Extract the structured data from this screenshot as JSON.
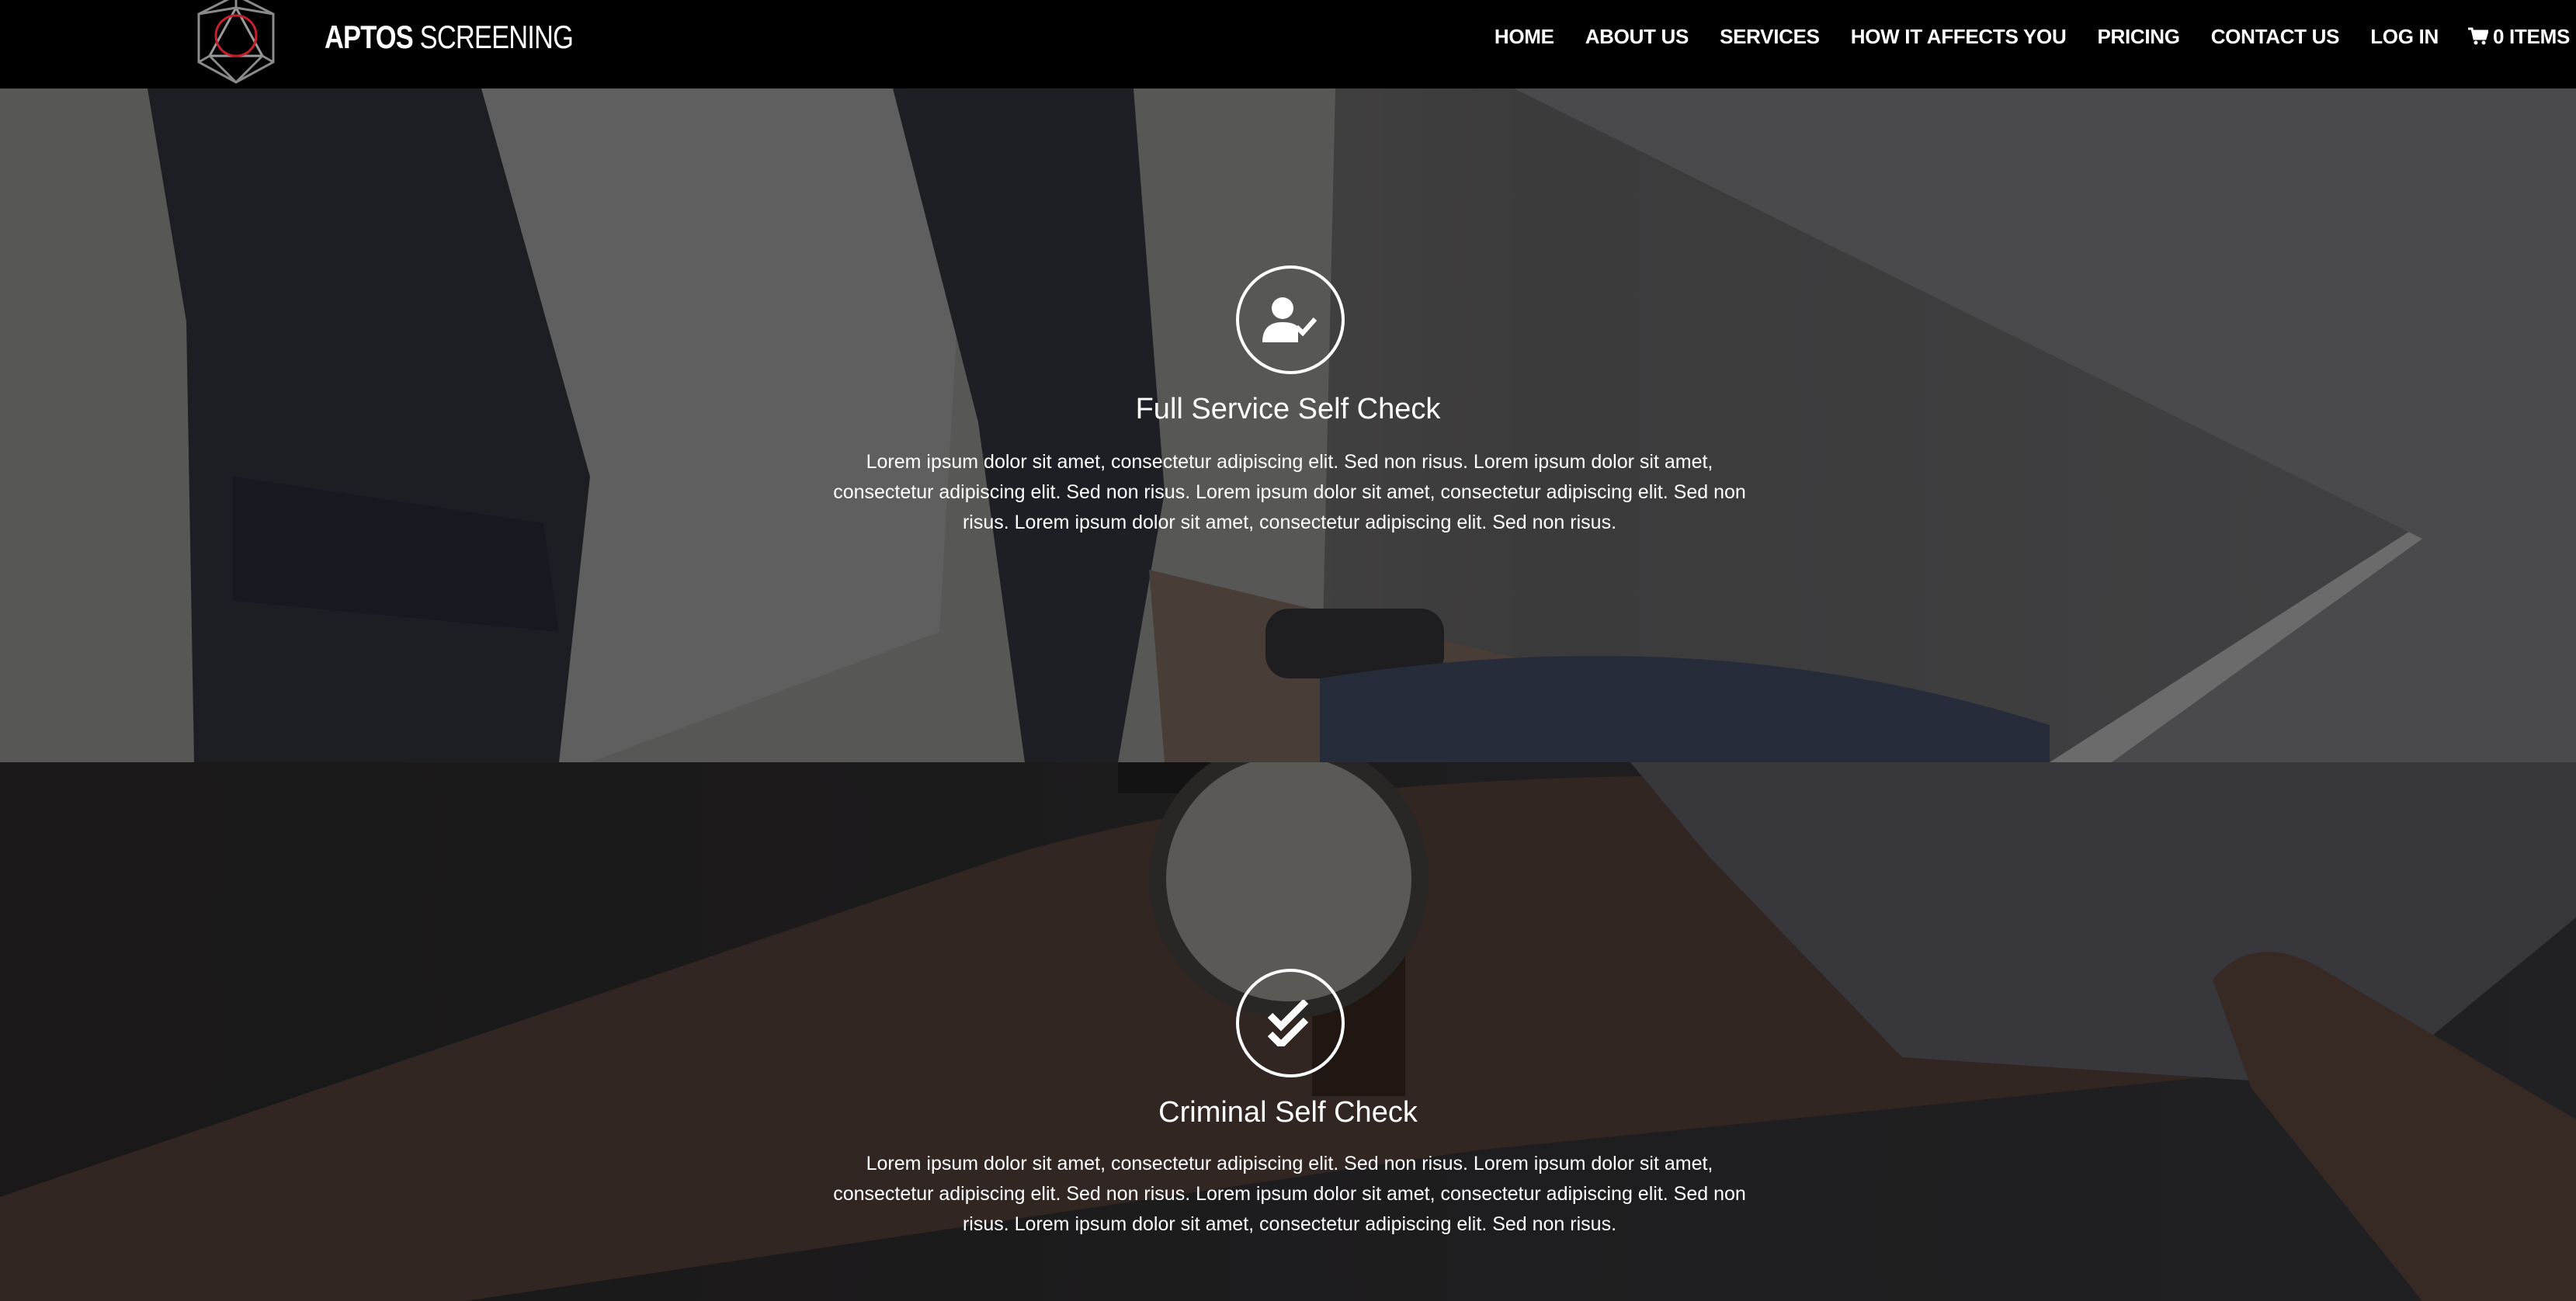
{
  "header": {
    "brand_bold": "APTOS",
    "brand_light": " SCREENING",
    "nav": [
      "HOME",
      "ABOUT US",
      "SERVICES",
      "HOW IT AFFECTS YOU",
      "PRICING",
      "CONTACT US",
      "LOG IN"
    ],
    "cart_label": "0 ITEMS"
  },
  "features": [
    {
      "icon": "user-check-icon",
      "title": "Full Service Self Check",
      "body": "Lorem ipsum dolor sit amet, consectetur adipiscing elit. Sed non risus. Lorem ipsum dolor sit amet, consectetur adipiscing elit. Sed non risus. Lorem ipsum dolor sit amet, consectetur adipiscing elit. Sed non risus. Lorem ipsum dolor sit amet, consectetur adipiscing elit. Sed non risus."
    },
    {
      "icon": "double-check-icon",
      "title": "Criminal Self Check",
      "body": "Lorem ipsum dolor sit amet, consectetur adipiscing elit. Sed non risus. Lorem ipsum dolor sit amet, consectetur adipiscing elit. Sed non risus. Lorem ipsum dolor sit amet, consectetur adipiscing elit. Sed non risus. Lorem ipsum dolor sit amet, consectetur adipiscing elit. Sed non risus."
    }
  ],
  "colors": {
    "header_bg": "#000000",
    "logo_accent": "#c8202a",
    "text": "#ffffff"
  }
}
